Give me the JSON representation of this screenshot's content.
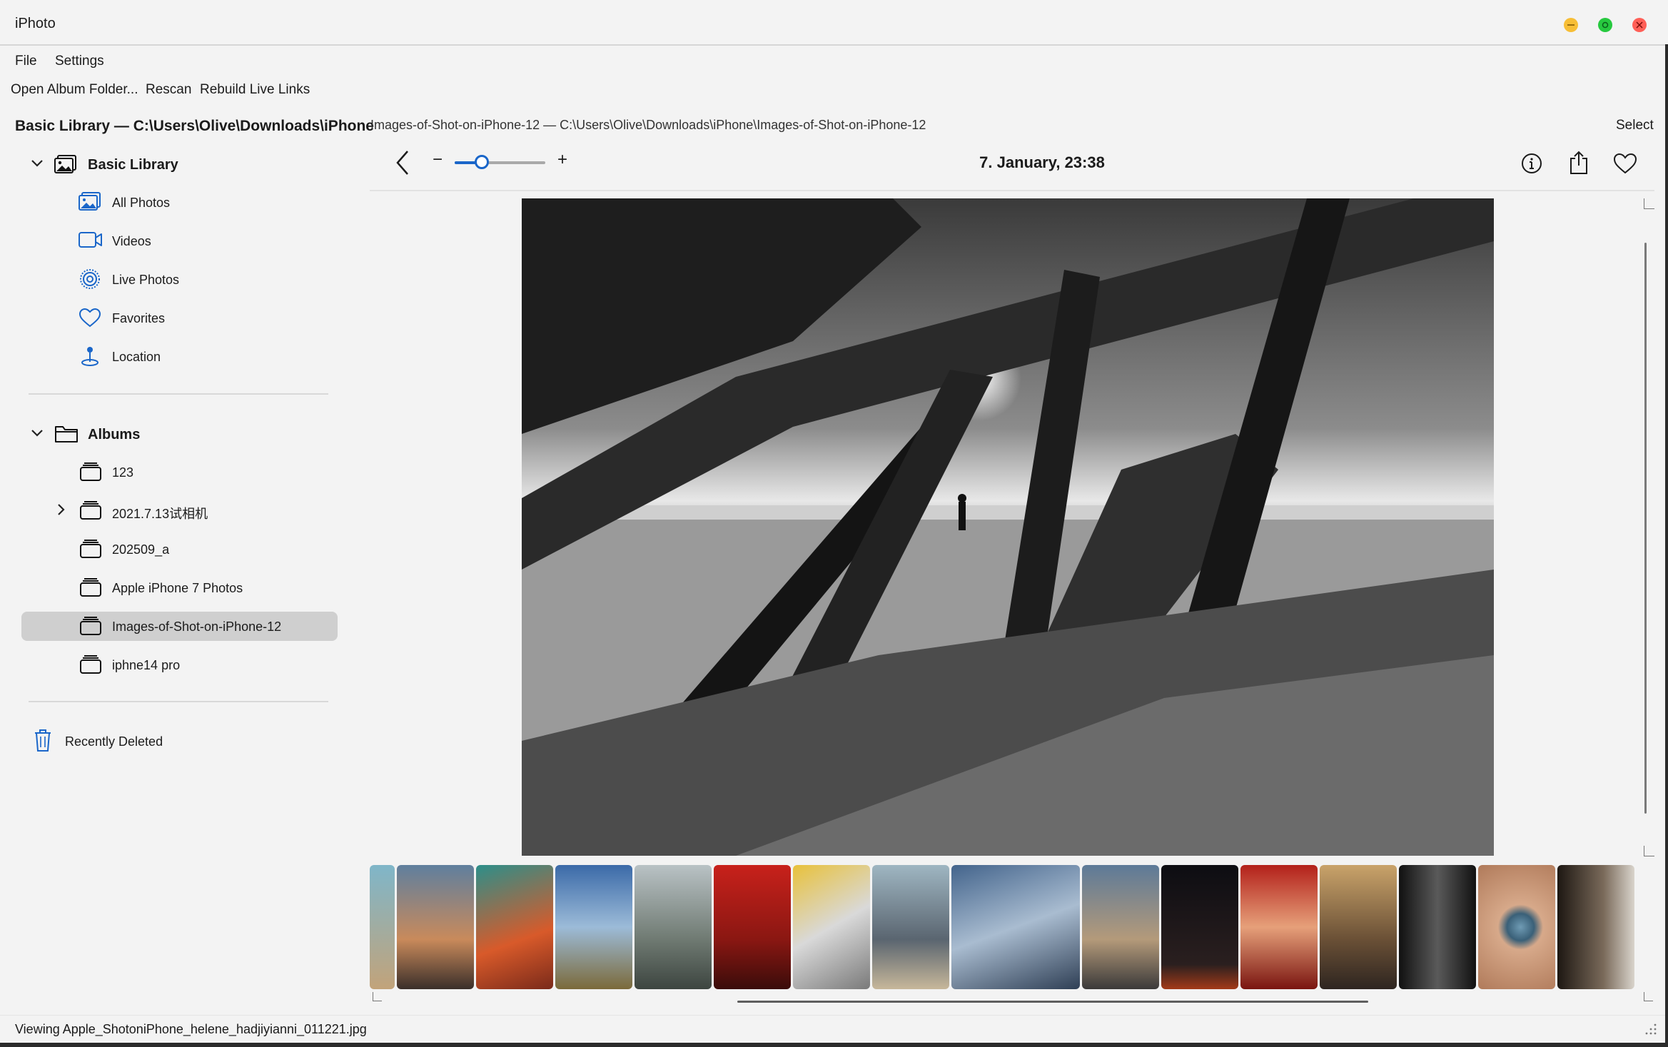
{
  "window": {
    "title": "iPhoto",
    "colors": {
      "minimize": "#f7be36",
      "maximize": "#27c93f",
      "close": "#ff5f57"
    }
  },
  "menu": {
    "file": "File",
    "settings": "Settings"
  },
  "toolbar": {
    "open_album_folder": "Open Album Folder...",
    "rescan": "Rescan",
    "rebuild_live_links": "Rebuild Live Links"
  },
  "sidebar": {
    "title": "Basic Library — C:\\Users\\Olive\\Downloads\\iPhone",
    "library_group": "Basic Library",
    "library_items": [
      {
        "label": "All Photos",
        "icon": "photos-icon"
      },
      {
        "label": "Videos",
        "icon": "video-icon"
      },
      {
        "label": "Live Photos",
        "icon": "live-photo-icon"
      },
      {
        "label": "Favorites",
        "icon": "heart-icon"
      },
      {
        "label": "Location",
        "icon": "location-pin-icon"
      }
    ],
    "albums_group": "Albums",
    "albums": [
      {
        "label": "123"
      },
      {
        "label": "2021.7.13试相机"
      },
      {
        "label": "202509_a"
      },
      {
        "label": "Apple iPhone 7 Photos"
      },
      {
        "label": "Images-of-Shot-on-iPhone-12",
        "selected": true
      },
      {
        "label": "iphne14 pro"
      }
    ],
    "recently_deleted": "Recently Deleted",
    "accent": "#1a66c9"
  },
  "main": {
    "breadcrumb": "Images-of-Shot-on-iPhone-12 — C:\\Users\\Olive\\Downloads\\iPhone\\Images-of-Shot-on-iPhone-12",
    "select_label": "Select",
    "date": "7. January, 23:38",
    "zoom_minus": "−",
    "zoom_plus": "+",
    "zoom_level": 0.3,
    "photo_description_icon": "photo-viewer"
  },
  "status": {
    "text": "Viewing Apple_ShotoniPhone_helene_hadjiyianni_011221.jpg"
  }
}
